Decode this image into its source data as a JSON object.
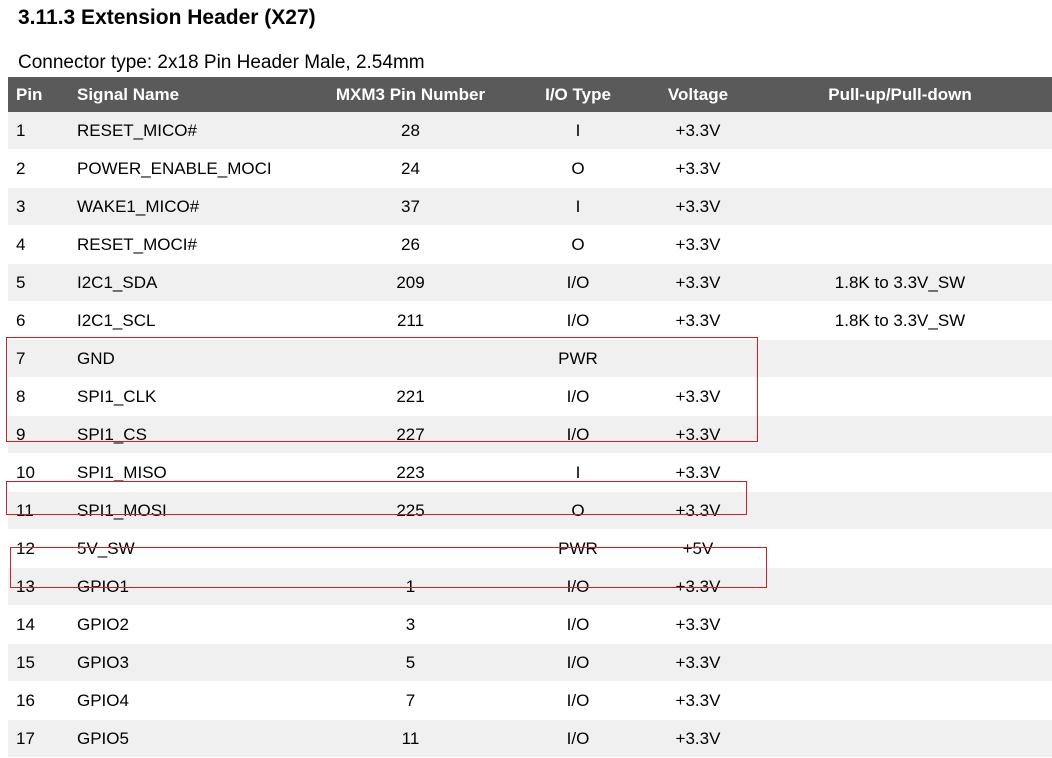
{
  "section": {
    "title": "3.11.3 Extension Header (X27)",
    "connector": "Connector type: 2x18 Pin Header Male, 2.54mm"
  },
  "table": {
    "headers": [
      "Pin",
      "Signal Name",
      "MXM3 Pin Number",
      "I/O Type",
      "Voltage",
      "Pull-up/Pull-down"
    ],
    "rows": [
      [
        "1",
        "RESET_MICO#",
        "28",
        "I",
        "+3.3V",
        ""
      ],
      [
        "2",
        "POWER_ENABLE_MOCI",
        "24",
        "O",
        "+3.3V",
        ""
      ],
      [
        "3",
        "WAKE1_MICO#",
        "37",
        "I",
        "+3.3V",
        ""
      ],
      [
        "4",
        "RESET_MOCI#",
        "26",
        "O",
        "+3.3V",
        ""
      ],
      [
        "5",
        "I2C1_SDA",
        "209",
        "I/O",
        "+3.3V",
        "1.8K to 3.3V_SW"
      ],
      [
        "6",
        "I2C1_SCL",
        "211",
        "I/O",
        "+3.3V",
        "1.8K to 3.3V_SW"
      ],
      [
        "7",
        "GND",
        "",
        "PWR",
        "",
        ""
      ],
      [
        "8",
        "SPI1_CLK",
        "221",
        "I/O",
        "+3.3V",
        ""
      ],
      [
        "9",
        "SPI1_CS",
        "227",
        "I/O",
        "+3.3V",
        ""
      ],
      [
        "10",
        "SPI1_MISO",
        "223",
        "I",
        "+3.3V",
        ""
      ],
      [
        "11",
        "SPI1_MOSI",
        "225",
        "O",
        "+3.3V",
        ""
      ],
      [
        "12",
        "5V_SW",
        "",
        "PWR",
        "+5V",
        ""
      ],
      [
        "13",
        "GPIO1",
        "1",
        "I/O",
        "+3.3V",
        ""
      ],
      [
        "14",
        "GPIO2",
        "3",
        "I/O",
        "+3.3V",
        ""
      ],
      [
        "15",
        "GPIO3",
        "5",
        "I/O",
        "+3.3V",
        ""
      ],
      [
        "16",
        "GPIO4",
        "7",
        "I/O",
        "+3.3V",
        ""
      ],
      [
        "17",
        "GPIO5",
        "11",
        "I/O",
        "+3.3V",
        ""
      ]
    ]
  },
  "highlight_color": "#d21f26"
}
